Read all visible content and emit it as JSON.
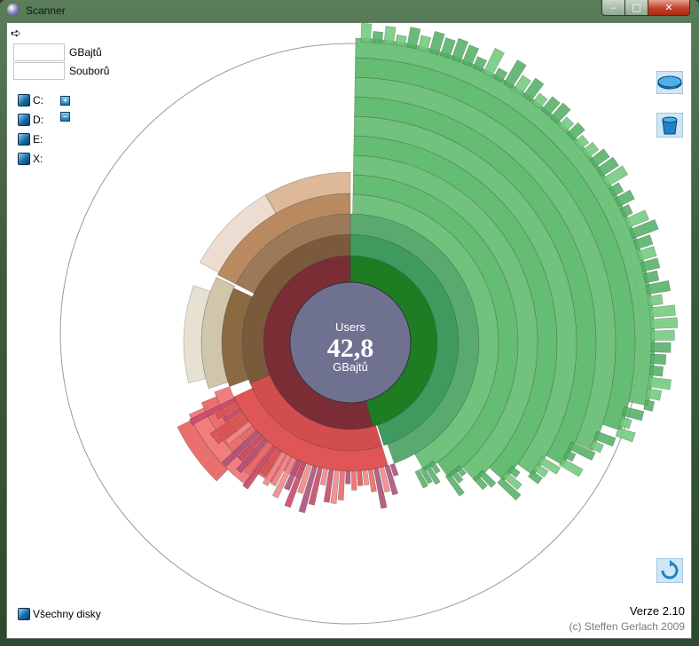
{
  "window": {
    "title": "Scanner",
    "minimize_glyph": "–",
    "maximize_glyph": "□",
    "close_glyph": "✕"
  },
  "toolbar": {
    "back_icon": "arrow-right-icon",
    "back_glyph": "➪"
  },
  "stats": {
    "size_unit_label": "GBajtů",
    "files_label": "Souborů",
    "size_value": "",
    "files_value": ""
  },
  "drives": [
    {
      "label": "C:"
    },
    {
      "label": "D:"
    },
    {
      "label": "E:"
    },
    {
      "label": "X:"
    }
  ],
  "zoom": {
    "plus": "+",
    "minus": "–"
  },
  "center": {
    "folder": "Users",
    "value": "42,8",
    "unit": "GBajtů"
  },
  "all_drives_label": "Všechny disky",
  "version": "Verze 2.10",
  "copyright": "(c) Steffen Gerlach 2009",
  "colors": {
    "center": "#6f7191",
    "green": "#3f9e55",
    "red": "#d84c4c",
    "brown": "#8c6238"
  }
}
